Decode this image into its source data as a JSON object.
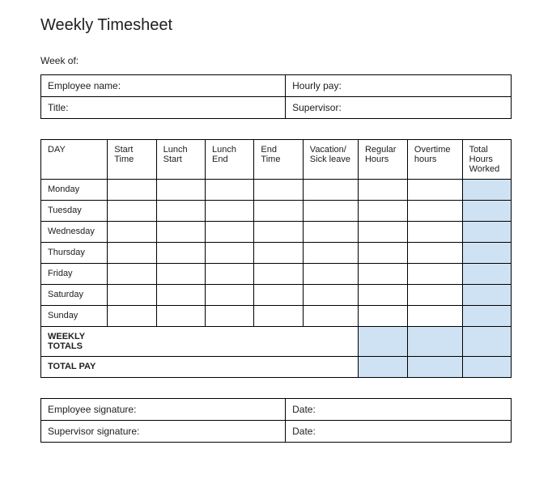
{
  "title": "Weekly Timesheet",
  "week_of_label": "Week of:",
  "info": {
    "employee_name_label": "Employee name:",
    "hourly_pay_label": "Hourly pay:",
    "title_label": "Title:",
    "supervisor_label": "Supervisor:"
  },
  "timesheet": {
    "headers": {
      "day": "DAY",
      "start_time": "Start Time",
      "lunch_start": "Lunch Start",
      "lunch_end": "Lunch End",
      "end_time": "End Time",
      "vacation": "Vacation/ Sick leave",
      "regular": "Regular Hours",
      "overtime": "Overtime hours",
      "total": "Total Hours Worked"
    },
    "days": [
      "Monday",
      "Tuesday",
      "Wednesday",
      "Thursday",
      "Friday",
      "Saturday",
      "Sunday"
    ],
    "weekly_totals_label": "WEEKLY TOTALS",
    "total_pay_label": "TOTAL PAY"
  },
  "signature": {
    "employee_label": "Employee signature:",
    "supervisor_label": "Supervisor signature:",
    "date_label": "Date:"
  }
}
